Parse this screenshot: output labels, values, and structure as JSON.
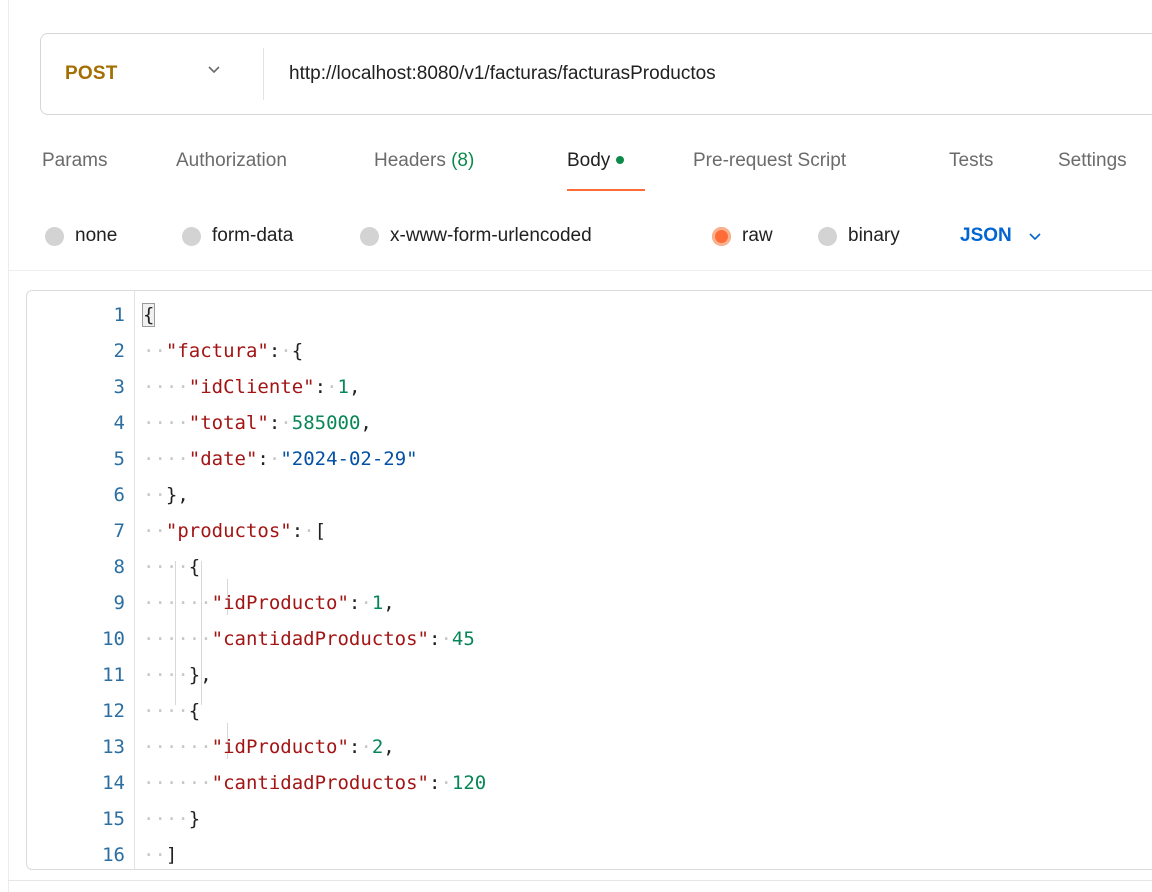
{
  "request": {
    "method": "POST",
    "url": "http://localhost:8080/v1/facturas/facturasProductos"
  },
  "tabs": [
    {
      "label": "Params"
    },
    {
      "label": "Authorization"
    },
    {
      "label": "Headers",
      "count": "(8)"
    },
    {
      "label": "Body",
      "active": true
    },
    {
      "label": "Pre-request Script"
    },
    {
      "label": "Tests"
    },
    {
      "label": "Settings"
    }
  ],
  "body_types": [
    {
      "label": "none",
      "checked": false
    },
    {
      "label": "form-data",
      "checked": false
    },
    {
      "label": "x-www-form-urlencoded",
      "checked": false
    },
    {
      "label": "raw",
      "checked": true
    },
    {
      "label": "binary",
      "checked": false
    }
  ],
  "format": {
    "selected": "JSON"
  },
  "editor": {
    "lines": [
      {
        "n": "1",
        "indent": 0,
        "tokens": [
          {
            "t": "{",
            "c": "punc"
          }
        ]
      },
      {
        "n": "2",
        "indent": 1,
        "tokens": [
          {
            "t": "\"factura\"",
            "c": "key"
          },
          {
            "t": ":",
            "c": "punc"
          },
          {
            "t": "·",
            "c": "ws"
          },
          {
            "t": "{",
            "c": "punc"
          }
        ]
      },
      {
        "n": "3",
        "indent": 2,
        "tokens": [
          {
            "t": "\"idCliente\"",
            "c": "key"
          },
          {
            "t": ":",
            "c": "punc"
          },
          {
            "t": "·",
            "c": "ws"
          },
          {
            "t": "1",
            "c": "num"
          },
          {
            "t": ",",
            "c": "punc"
          }
        ]
      },
      {
        "n": "4",
        "indent": 2,
        "tokens": [
          {
            "t": "\"total\"",
            "c": "key"
          },
          {
            "t": ":",
            "c": "punc"
          },
          {
            "t": "·",
            "c": "ws"
          },
          {
            "t": "585000",
            "c": "num"
          },
          {
            "t": ",",
            "c": "punc"
          }
        ]
      },
      {
        "n": "5",
        "indent": 2,
        "tokens": [
          {
            "t": "\"date\"",
            "c": "key"
          },
          {
            "t": ":",
            "c": "punc"
          },
          {
            "t": "·",
            "c": "ws"
          },
          {
            "t": "\"2024-02-29\"",
            "c": "str"
          }
        ]
      },
      {
        "n": "6",
        "indent": 1,
        "tokens": [
          {
            "t": "},",
            "c": "punc"
          }
        ]
      },
      {
        "n": "7",
        "indent": 1,
        "tokens": [
          {
            "t": "\"productos\"",
            "c": "key"
          },
          {
            "t": ":",
            "c": "punc"
          },
          {
            "t": "·",
            "c": "ws"
          },
          {
            "t": "[",
            "c": "punc"
          }
        ]
      },
      {
        "n": "8",
        "indent": 2,
        "tokens": [
          {
            "t": "{",
            "c": "punc"
          }
        ]
      },
      {
        "n": "9",
        "indent": 3,
        "tokens": [
          {
            "t": "\"idProducto\"",
            "c": "key"
          },
          {
            "t": ":",
            "c": "punc"
          },
          {
            "t": "·",
            "c": "ws"
          },
          {
            "t": "1",
            "c": "num"
          },
          {
            "t": ",",
            "c": "punc"
          }
        ]
      },
      {
        "n": "10",
        "indent": 3,
        "tokens": [
          {
            "t": "\"cantidadProductos\"",
            "c": "key"
          },
          {
            "t": ":",
            "c": "punc"
          },
          {
            "t": "·",
            "c": "ws"
          },
          {
            "t": "45",
            "c": "num"
          }
        ]
      },
      {
        "n": "11",
        "indent": 2,
        "tokens": [
          {
            "t": "},",
            "c": "punc"
          }
        ]
      },
      {
        "n": "12",
        "indent": 2,
        "tokens": [
          {
            "t": "{",
            "c": "punc"
          }
        ]
      },
      {
        "n": "13",
        "indent": 3,
        "tokens": [
          {
            "t": "\"idProducto\"",
            "c": "key"
          },
          {
            "t": ":",
            "c": "punc"
          },
          {
            "t": "·",
            "c": "ws"
          },
          {
            "t": "2",
            "c": "num"
          },
          {
            "t": ",",
            "c": "punc"
          }
        ]
      },
      {
        "n": "14",
        "indent": 3,
        "tokens": [
          {
            "t": "\"cantidadProductos\"",
            "c": "key"
          },
          {
            "t": ":",
            "c": "punc"
          },
          {
            "t": "·",
            "c": "ws"
          },
          {
            "t": "120",
            "c": "num"
          }
        ]
      },
      {
        "n": "15",
        "indent": 2,
        "tokens": [
          {
            "t": "}",
            "c": "punc"
          }
        ]
      },
      {
        "n": "16",
        "indent": 1,
        "tokens": [
          {
            "t": "]",
            "c": "punc"
          }
        ]
      }
    ]
  }
}
